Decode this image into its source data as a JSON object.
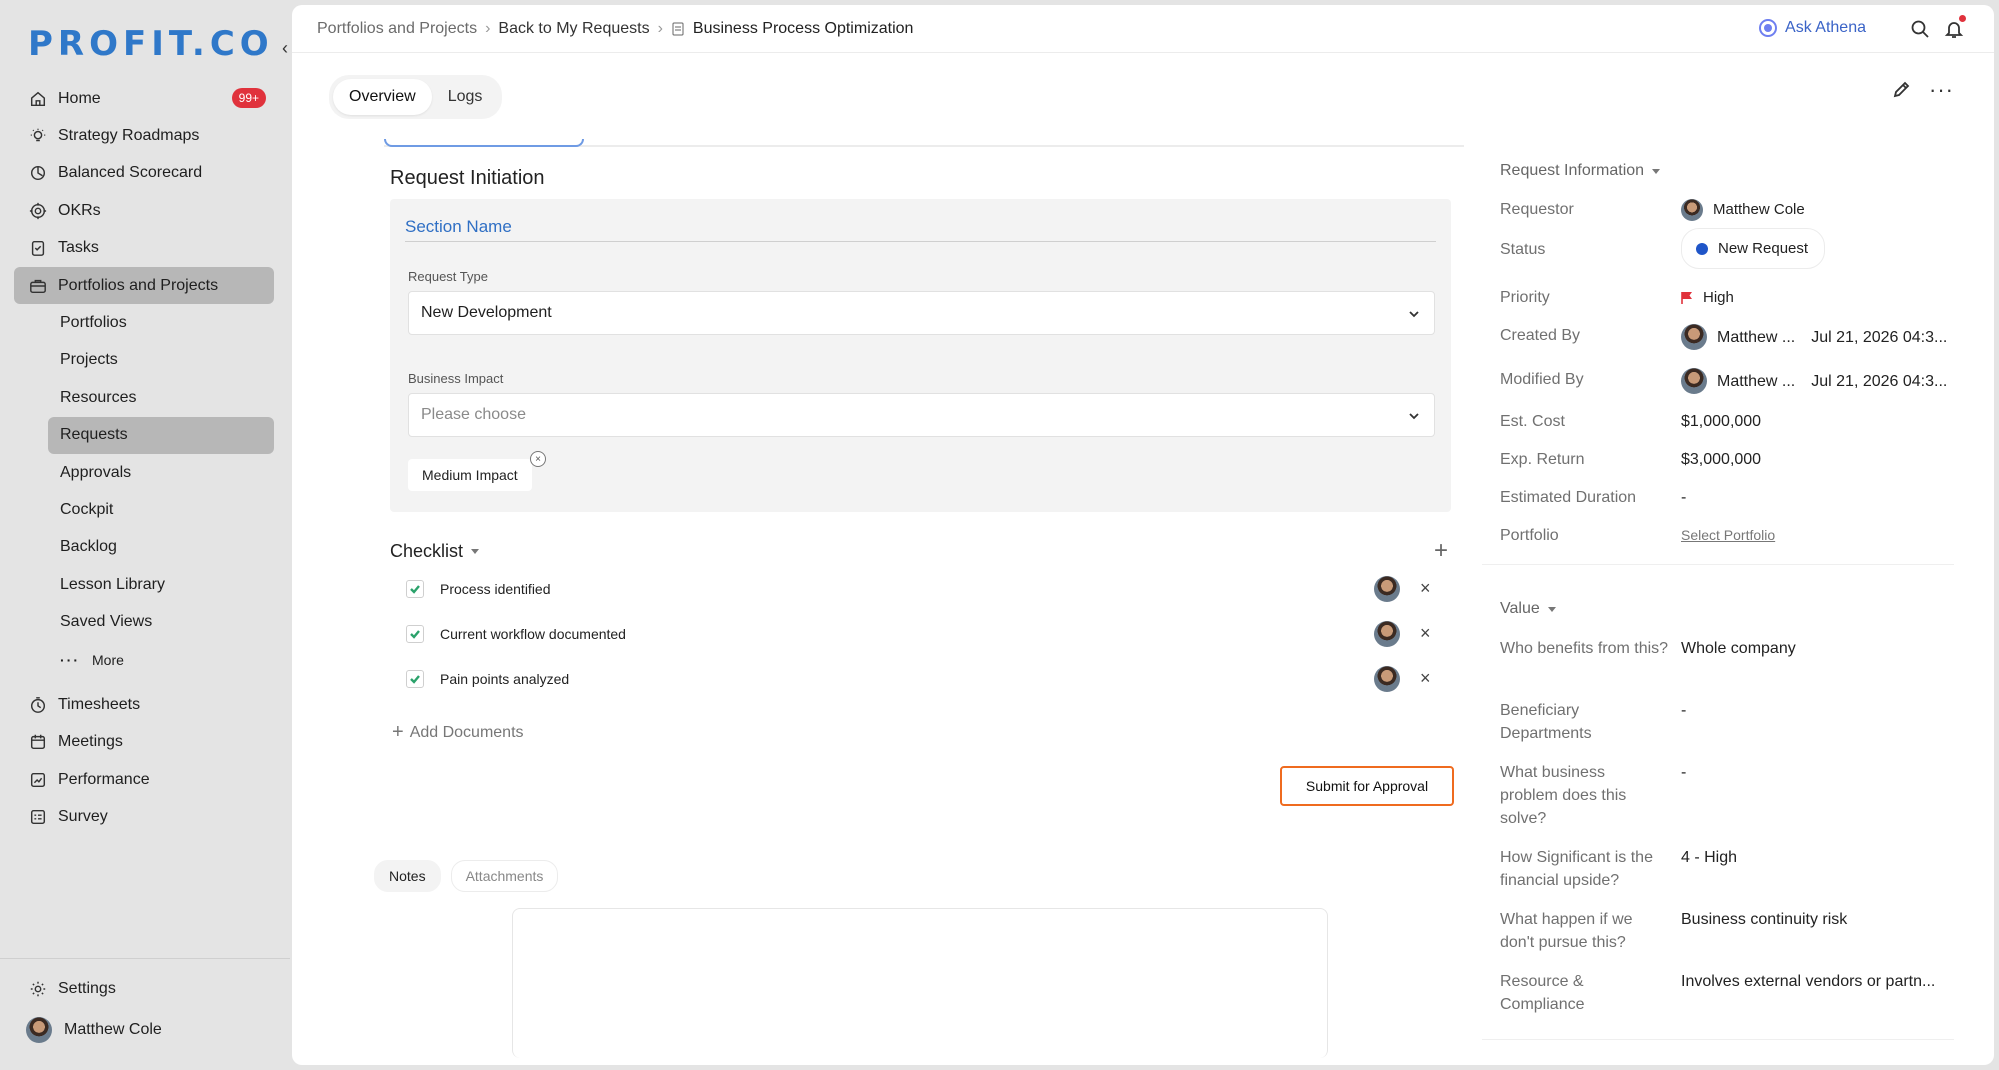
{
  "brand": {
    "logo_text": "PROFIT.CO"
  },
  "sidebar": {
    "home_badge": "99+",
    "items": [
      {
        "label": "Home",
        "icon": "home-icon"
      },
      {
        "label": "Strategy Roadmaps",
        "icon": "lightbulb-icon"
      },
      {
        "label": "Balanced Scorecard",
        "icon": "scorecard-icon"
      },
      {
        "label": "OKRs",
        "icon": "target-icon"
      },
      {
        "label": "Tasks",
        "icon": "clipboard-icon"
      },
      {
        "label": "Portfolios and Projects",
        "icon": "briefcase-icon"
      }
    ],
    "sub_items": [
      "Portfolios",
      "Projects",
      "Resources",
      "Requests",
      "Approvals",
      "Cockpit",
      "Backlog",
      "Lesson Library",
      "Saved Views",
      "More"
    ],
    "items_after": [
      {
        "label": "Timesheets",
        "icon": "clock-icon"
      },
      {
        "label": "Meetings",
        "icon": "calendar-icon"
      },
      {
        "label": "Performance",
        "icon": "chart-icon"
      },
      {
        "label": "Survey",
        "icon": "survey-icon"
      }
    ],
    "settings_label": "Settings",
    "user_name": "Matthew Cole"
  },
  "breadcrumb": {
    "items": [
      "Portfolios and Projects",
      "Back to My Requests",
      "Business Process Optimization"
    ],
    "separator": "›"
  },
  "header": {
    "ask_label": "Ask Athena"
  },
  "tabs": [
    "Overview",
    "Logs"
  ],
  "form": {
    "title": "Request Initiation",
    "section_name": "Section Name",
    "request_type_label": "Request Type",
    "request_type_value": "New Development",
    "business_impact_label": "Business Impact",
    "business_impact_placeholder": "Please choose",
    "business_impact_chip": "Medium Impact",
    "chip_remove": "×",
    "checklist_title": "Checklist",
    "add_symbol": "+",
    "checklist": [
      {
        "label": "Process identified",
        "checked": true
      },
      {
        "label": "Current workflow documented",
        "checked": true
      },
      {
        "label": "Pain points analyzed",
        "checked": true
      }
    ],
    "remove_symbol": "×",
    "add_documents": "Add Documents",
    "submit_label": "Submit for Approval"
  },
  "notes_tabs": [
    "Notes",
    "Attachments"
  ],
  "info": {
    "title": "Request Information",
    "requestor_label": "Requestor",
    "requestor": "Matthew Cole",
    "status_label": "Status",
    "status": "New Request",
    "status_color": "#1f55c8",
    "priority_label": "Priority",
    "priority": "High",
    "priority_color": "#e0323c",
    "created_by_label": "Created By",
    "created_by": "Matthew ...",
    "created_date": "Jul 21, 2026 04:3...",
    "modified_by_label": "Modified By",
    "modified_by": "Matthew ...",
    "modified_date": "Jul 21, 2026 04:3...",
    "est_cost_label": "Est. Cost",
    "est_cost": "$1,000,000",
    "exp_return_label": "Exp. Return",
    "exp_return": "$3,000,000",
    "duration_label": "Estimated Duration",
    "duration": "-",
    "portfolio_label": "Portfolio",
    "portfolio_link": "Select Portfolio"
  },
  "value": {
    "title": "Value",
    "rows": [
      {
        "key": "Who benefits from this?",
        "val": "Whole company"
      },
      {
        "key": "Beneficiary Departments",
        "val": "-"
      },
      {
        "key": "What business problem does this solve?",
        "val": "-"
      },
      {
        "key": "How Significant is the financial upside?",
        "val": "4 - High"
      },
      {
        "key": "What happen if we don't pursue this?",
        "val": "Business continuity risk"
      },
      {
        "key": "Resource & Compliance",
        "val": "Involves external vendors or partn..."
      }
    ]
  },
  "colors": {
    "accent": "#2f78c9",
    "highlight": "#ef6b1f",
    "badge": "#e0323c"
  }
}
